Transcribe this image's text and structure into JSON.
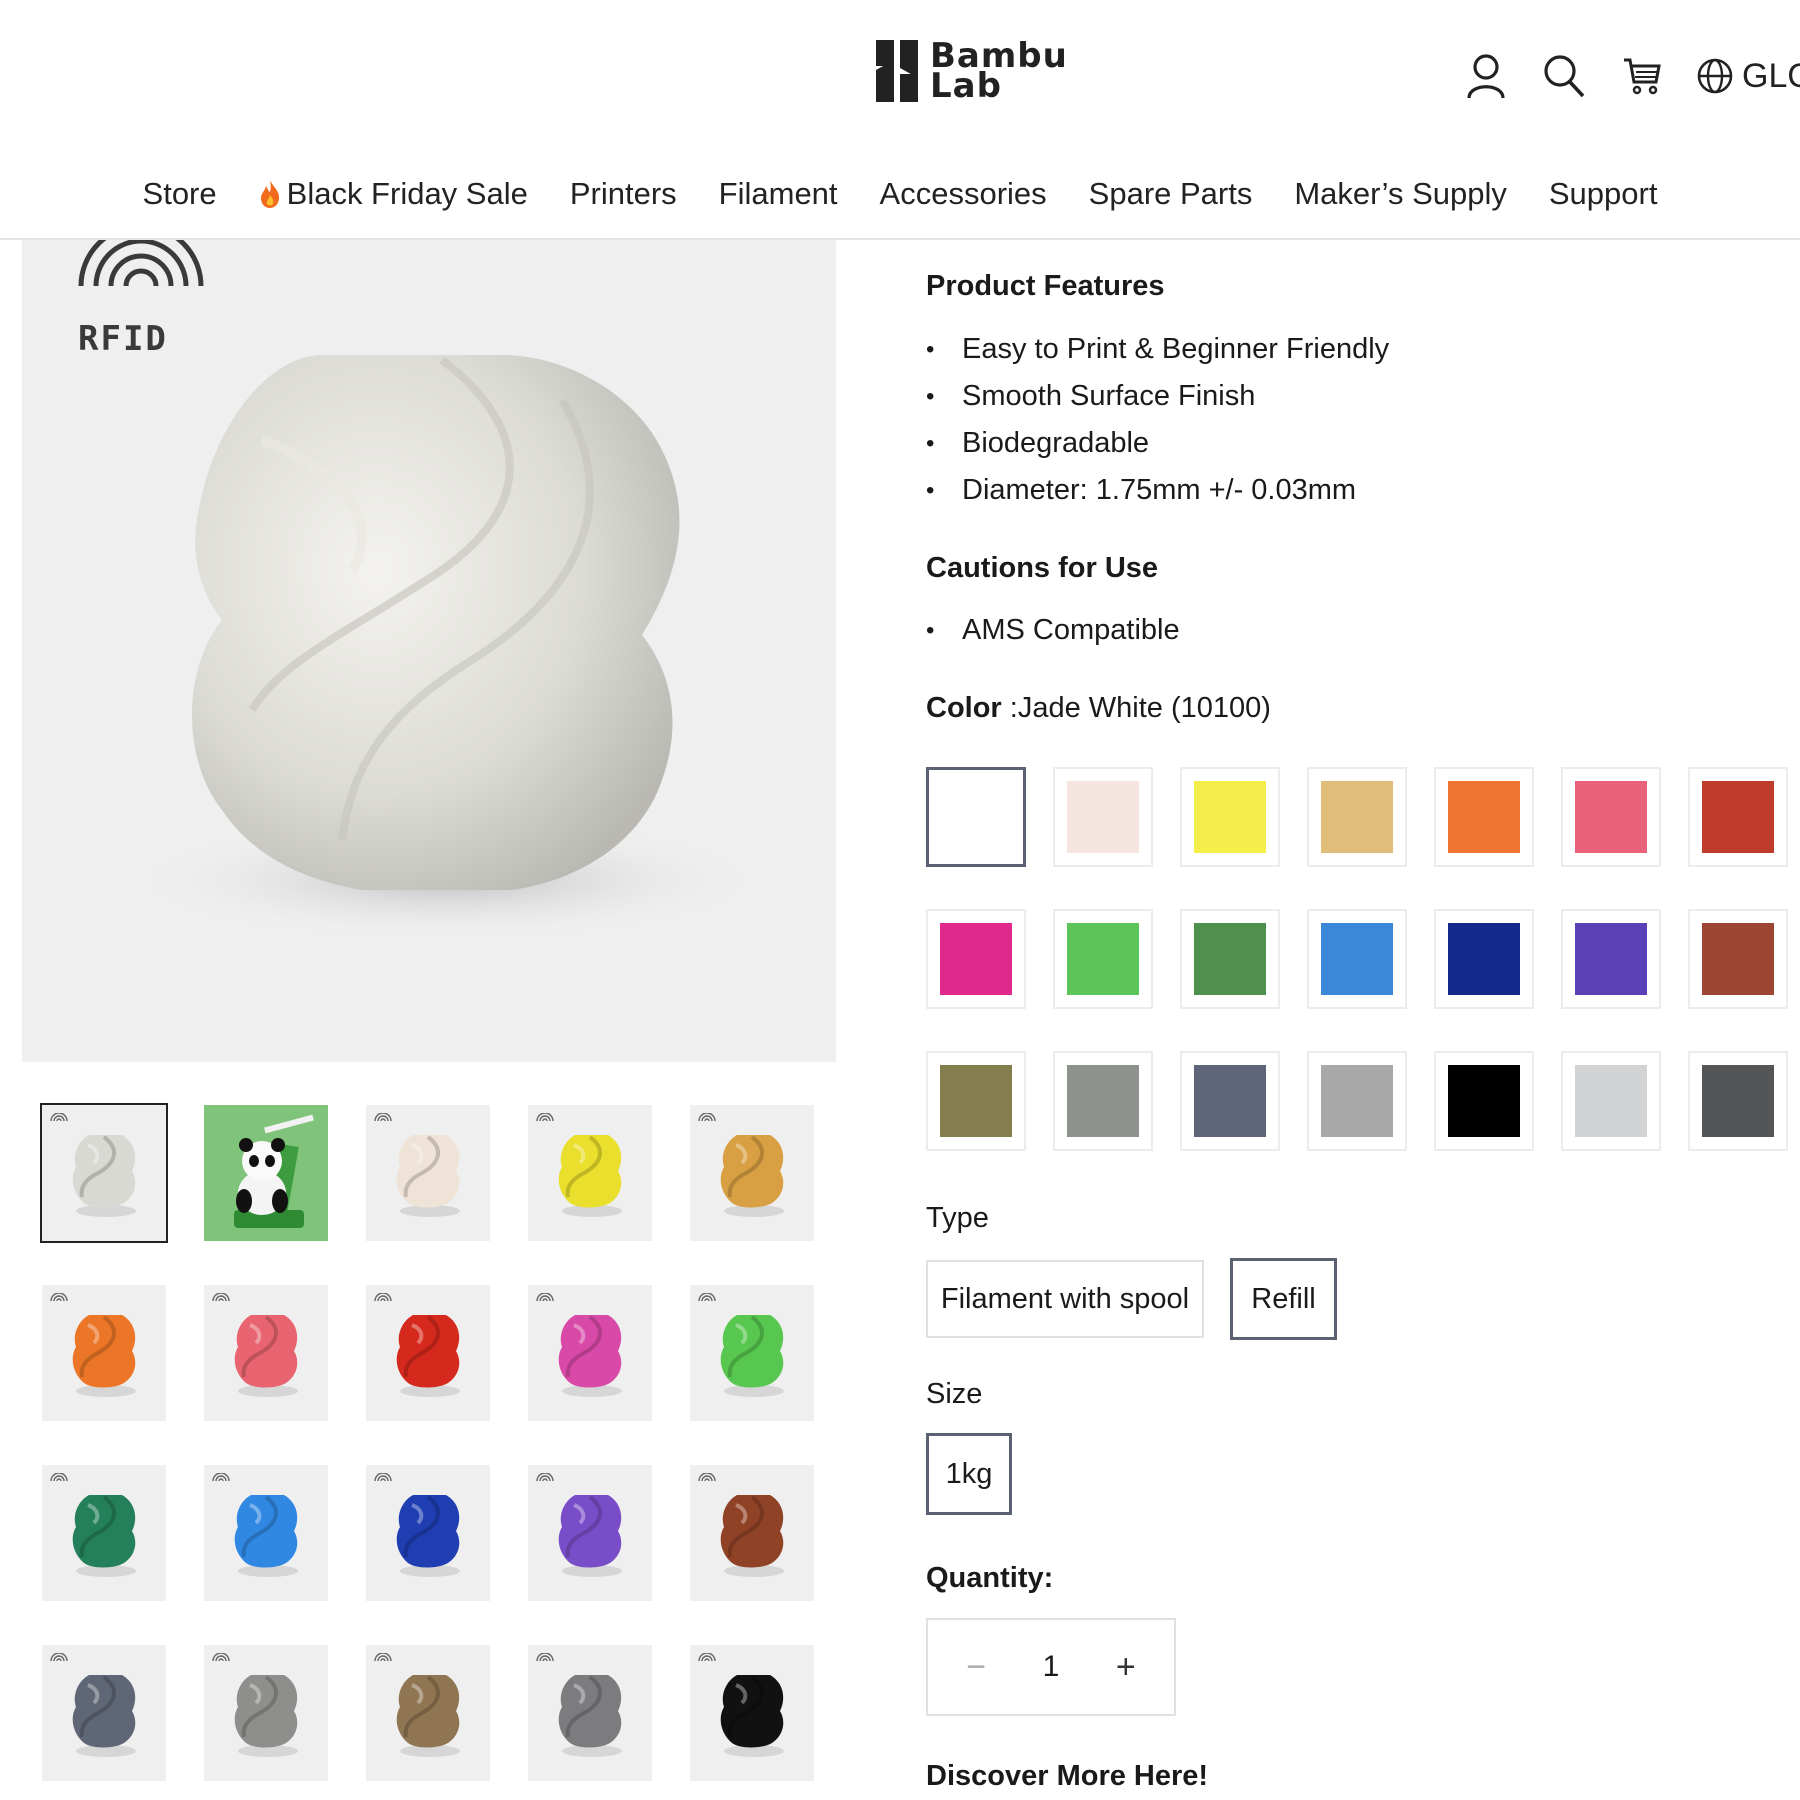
{
  "header": {
    "logo_line1": "Bambu",
    "logo_line2": "Lab",
    "lang_label": "GLOBAL"
  },
  "nav": [
    {
      "label": "Store",
      "icon": ""
    },
    {
      "label": "Black Friday Sale",
      "icon": "fire-icon"
    },
    {
      "label": "Printers",
      "icon": ""
    },
    {
      "label": "Filament",
      "icon": ""
    },
    {
      "label": "Accessories",
      "icon": ""
    },
    {
      "label": "Spare Parts",
      "icon": ""
    },
    {
      "label": "Maker’s Supply",
      "icon": ""
    },
    {
      "label": "Support",
      "icon": ""
    }
  ],
  "gallery": {
    "main_badge": "RFID",
    "thumbnails": [
      {
        "kind": "vase",
        "color": "#d9d9d4",
        "selected": true
      },
      {
        "kind": "panda",
        "color": "#7fc47a",
        "selected": false
      },
      {
        "kind": "vase",
        "color": "#efe3d7",
        "selected": false
      },
      {
        "kind": "vase",
        "color": "#eadf2c",
        "selected": false
      },
      {
        "kind": "vase",
        "color": "#d9a043",
        "selected": false
      },
      {
        "kind": "vase",
        "color": "#ec7627",
        "selected": false
      },
      {
        "kind": "vase",
        "color": "#e86470",
        "selected": false
      },
      {
        "kind": "vase",
        "color": "#d6291d",
        "selected": false
      },
      {
        "kind": "vase",
        "color": "#d94aa8",
        "selected": false
      },
      {
        "kind": "vase",
        "color": "#57c74f",
        "selected": false
      },
      {
        "kind": "vase",
        "color": "#24805a",
        "selected": false
      },
      {
        "kind": "vase",
        "color": "#3188e3",
        "selected": false
      },
      {
        "kind": "vase",
        "color": "#1e3eb2",
        "selected": false
      },
      {
        "kind": "vase",
        "color": "#7a4dc8",
        "selected": false
      },
      {
        "kind": "vase",
        "color": "#904226",
        "selected": false
      },
      {
        "kind": "vase",
        "color": "#5f6675",
        "selected": false
      },
      {
        "kind": "vase",
        "color": "#8e8e8c",
        "selected": false
      },
      {
        "kind": "vase",
        "color": "#8f7552",
        "selected": false
      },
      {
        "kind": "vase",
        "color": "#7c7c7e",
        "selected": false
      },
      {
        "kind": "vase",
        "color": "#111111",
        "selected": false
      }
    ]
  },
  "features": {
    "title": "Product Features",
    "items": [
      "Easy to Print & Beginner Friendly",
      "Smooth Surface Finish",
      "Biodegradable",
      "Diameter: 1.75mm +/- 0.03mm"
    ]
  },
  "cautions": {
    "title": "Cautions for Use",
    "items": [
      "AMS Compatible"
    ]
  },
  "color": {
    "label": "Color",
    "value": ":Jade White (10100)",
    "swatches": [
      {
        "hex": "#ffffff",
        "selected": true
      },
      {
        "hex": "#f4e6de",
        "selected": false
      },
      {
        "hex": "#f4ee4b",
        "selected": false
      },
      {
        "hex": "#e0bd78",
        "selected": false
      },
      {
        "hex": "#ef7632",
        "selected": false
      },
      {
        "hex": "#e8637a",
        "selected": false
      },
      {
        "hex": "#bf3b2b",
        "selected": false
      },
      {
        "hex": "#df2a8c",
        "selected": false
      },
      {
        "hex": "#5dc45a",
        "selected": false
      },
      {
        "hex": "#4f904c",
        "selected": false
      },
      {
        "hex": "#3b88d8",
        "selected": false
      },
      {
        "hex": "#14288a",
        "selected": false
      },
      {
        "hex": "#5a41b8",
        "selected": false
      },
      {
        "hex": "#9c4533",
        "selected": false
      },
      {
        "hex": "#847e4e",
        "selected": false
      },
      {
        "hex": "#8d928c",
        "selected": false
      },
      {
        "hex": "#5e6579",
        "selected": false
      },
      {
        "hex": "#a8a8a9",
        "selected": false
      },
      {
        "hex": "#000000",
        "selected": false
      },
      {
        "hex": "#d2d3d4",
        "selected": false
      },
      {
        "hex": "#545557",
        "selected": false
      }
    ]
  },
  "type": {
    "label": "Type",
    "options": [
      {
        "label": "Filament with spool",
        "selected": false
      },
      {
        "label": "Refill",
        "selected": true
      }
    ]
  },
  "size": {
    "label": "Size",
    "options": [
      {
        "label": "1kg",
        "selected": true
      }
    ]
  },
  "quantity": {
    "label": "Quantity:",
    "value": "1",
    "minus": "−",
    "plus": "+"
  },
  "discover": {
    "label": "Discover More Here!"
  }
}
